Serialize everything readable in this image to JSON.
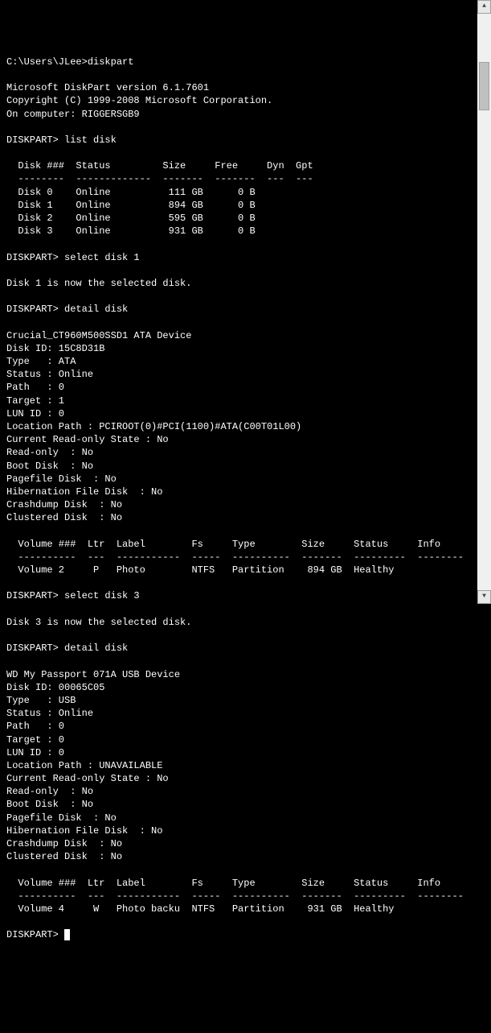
{
  "prompt_path": "C:\\Users\\JLee>",
  "cmd_diskpart": "diskpart",
  "header": {
    "line1": "Microsoft DiskPart version 6.1.7601",
    "line2": "Copyright (C) 1999-2008 Microsoft Corporation.",
    "line3": "On computer: RIGGERSGB9"
  },
  "dp_prompt": "DISKPART>",
  "cmd1": "list disk",
  "list_disk": {
    "hdr": "  Disk ###  Status         Size     Free     Dyn  Gpt",
    "sep": "  --------  -------------  -------  -------  ---  ---",
    "r0": "  Disk 0    Online          111 GB      0 B",
    "r1": "  Disk 1    Online          894 GB      0 B",
    "r2": "  Disk 2    Online          595 GB      0 B",
    "r3": "  Disk 3    Online          931 GB      0 B"
  },
  "cmd2": "select disk 1",
  "msg_sel1": "Disk 1 is now the selected disk.",
  "cmd3": "detail disk",
  "detail1": {
    "l0": "Crucial_CT960M500SSD1 ATA Device",
    "l1": "Disk ID: 15C8D31B",
    "l2": "Type   : ATA",
    "l3": "Status : Online",
    "l4": "Path   : 0",
    "l5": "Target : 1",
    "l6": "LUN ID : 0",
    "l7": "Location Path : PCIROOT(0)#PCI(1100)#ATA(C00T01L00)",
    "l8": "Current Read-only State : No",
    "l9": "Read-only  : No",
    "l10": "Boot Disk  : No",
    "l11": "Pagefile Disk  : No",
    "l12": "Hibernation File Disk  : No",
    "l13": "Crashdump Disk  : No",
    "l14": "Clustered Disk  : No"
  },
  "vol1": {
    "hdr": "  Volume ###  Ltr  Label        Fs     Type        Size     Status     Info",
    "sep": "  ----------  ---  -----------  -----  ----------  -------  ---------  --------",
    "row": "  Volume 2     P   Photo        NTFS   Partition    894 GB  Healthy"
  },
  "cmd4": "select disk 3",
  "msg_sel3": "Disk 3 is now the selected disk.",
  "cmd5": "detail disk",
  "detail2": {
    "l0": "WD My Passport 071A USB Device",
    "l1": "Disk ID: 00065C05",
    "l2": "Type   : USB",
    "l3": "Status : Online",
    "l4": "Path   : 0",
    "l5": "Target : 0",
    "l6": "LUN ID : 0",
    "l7": "Location Path : UNAVAILABLE",
    "l8": "Current Read-only State : No",
    "l9": "Read-only  : No",
    "l10": "Boot Disk  : No",
    "l11": "Pagefile Disk  : No",
    "l12": "Hibernation File Disk  : No",
    "l13": "Crashdump Disk  : No",
    "l14": "Clustered Disk  : No"
  },
  "vol2": {
    "hdr": "  Volume ###  Ltr  Label        Fs     Type        Size     Status     Info",
    "sep": "  ----------  ---  -----------  -----  ----------  -------  ---------  --------",
    "row": "  Volume 4     W   Photo backu  NTFS   Partition    931 GB  Healthy"
  }
}
